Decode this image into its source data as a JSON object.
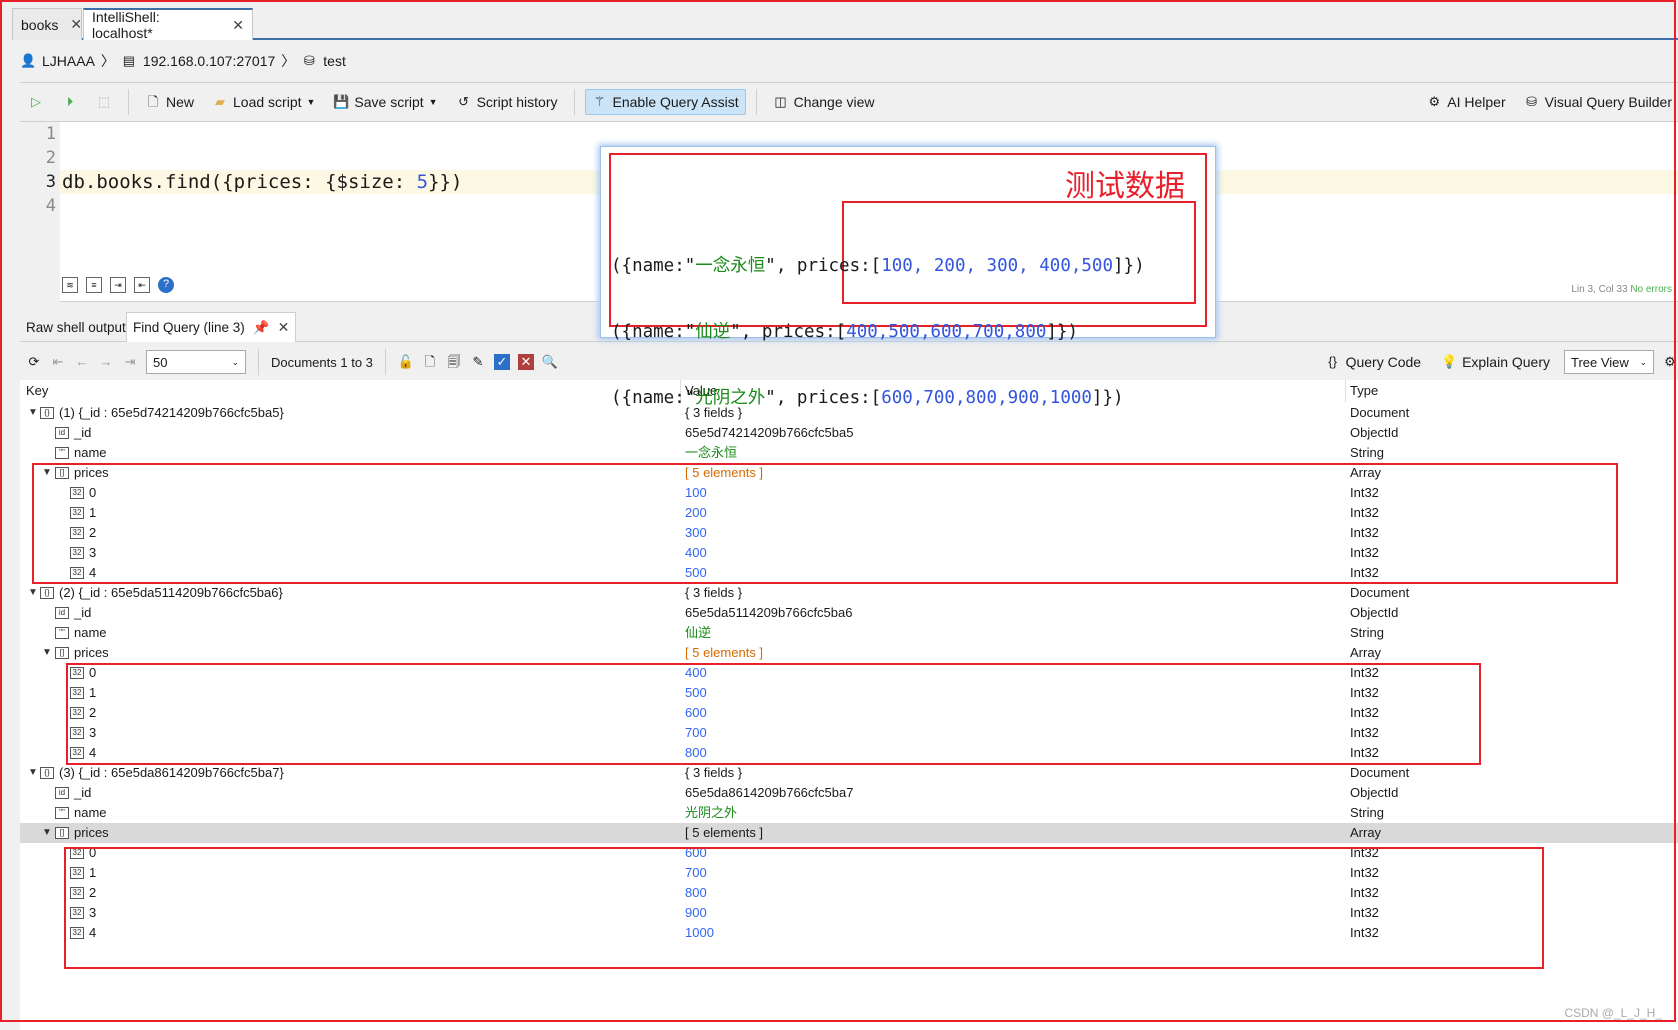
{
  "tabs": [
    {
      "label": "books"
    },
    {
      "label": "IntelliShell: localhost*"
    }
  ],
  "breadcrumb": {
    "user": "LJHAAA",
    "server": "192.168.0.107:27017",
    "database": "test"
  },
  "toolbar": {
    "new": "New",
    "load": "Load script",
    "save": "Save script",
    "history": "Script history",
    "assist": "Enable Query Assist",
    "change_view": "Change view",
    "ai": "AI Helper",
    "vqb": "Visual Query Builder"
  },
  "editor": {
    "line_numbers": [
      "1",
      "2",
      "3",
      "4"
    ],
    "code": "db.books.find({prices: {$size: ",
    "code_num": "5",
    "code_end": "}})",
    "status": "Lin 3, Col 33",
    "status2": "No errors"
  },
  "result_tabs": [
    {
      "label": "Raw shell output"
    },
    {
      "label": "Find Query (line 3)"
    }
  ],
  "result_toolbar": {
    "page_size": "50",
    "docs_label": "Documents 1 to 3",
    "query_code": "Query Code",
    "explain": "Explain Query",
    "view": "Tree View"
  },
  "columns": {
    "key": "Key",
    "value": "Value",
    "type": "Type"
  },
  "documents": [
    {
      "label": "(1) {_id : 65e5d74214209b766cfc5ba5}",
      "value": "{ 3 fields }",
      "type": "Document",
      "id": "65e5d74214209b766cfc5ba5",
      "name": "一念永恒",
      "prices_value": "[ 5 elements ]",
      "prices": [
        "100",
        "200",
        "300",
        "400",
        "500"
      ]
    },
    {
      "label": "(2) {_id : 65e5da5114209b766cfc5ba6}",
      "value": "{ 3 fields }",
      "type": "Document",
      "id": "65e5da5114209b766cfc5ba6",
      "name": "仙逆",
      "prices_value": "[ 5 elements ]",
      "prices": [
        "400",
        "500",
        "600",
        "700",
        "800"
      ]
    },
    {
      "label": "(3) {_id : 65e5da8614209b766cfc5ba7}",
      "value": "{ 3 fields }",
      "type": "Document",
      "id": "65e5da8614209b766cfc5ba7",
      "name": "光阴之外",
      "prices_value": "[ 5 elements ]",
      "prices": [
        "600",
        "700",
        "800",
        "900",
        "1000"
      ]
    }
  ],
  "field_labels": {
    "id": "_id",
    "name": "name",
    "prices": "prices"
  },
  "types": {
    "id": "ObjectId",
    "name": "String",
    "array": "Array",
    "int": "Int32"
  },
  "popup": {
    "title": "测试数据",
    "lines": [
      {
        "pre": "({name:\"",
        "name": "一念永恒",
        "mid": "\", prices:[",
        "nums": "100, 200, 300, 400,500",
        "end": "]})"
      },
      {
        "pre": "({name:\"",
        "name": "仙逆",
        "mid": "\", prices:[",
        "nums": "400,500,600,700,800",
        "end": "]})"
      },
      {
        "pre": "({name:\"",
        "name": "光阴之外",
        "mid": "\", prices:[",
        "nums": "600,700,800,900,1000",
        "end": "]})"
      }
    ]
  },
  "watermark": "CSDN @_L_J_H_",
  "colors": {
    "accent": "#3c6fa8",
    "annotation": "#e8202a",
    "string": "#1a8a1a",
    "number": "#3366ee"
  }
}
